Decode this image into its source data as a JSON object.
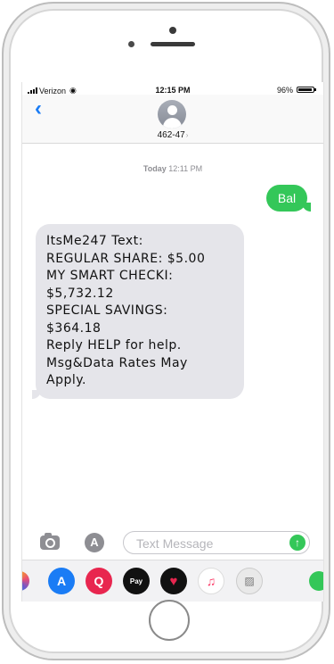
{
  "status_bar": {
    "carrier": "Verizon",
    "time": "12:15 PM",
    "battery": "96%",
    "battery_level": 0.96
  },
  "nav": {
    "back_icon": "chevron-left-icon",
    "contact": "462-47",
    "chevron": "›"
  },
  "thread": {
    "timestamp_day": "Today",
    "timestamp_time": "12:11 PM",
    "outgoing": "Bal",
    "incoming_lines": [
      "ItsMe247 Text:",
      "REGULAR SHARE: $5.00",
      "MY SMART CHECKI:",
      "$5,732.12",
      "SPECIAL SAVINGS:",
      "$364.18",
      "Reply HELP for help.",
      "Msg&Data Rates May",
      "Apply."
    ]
  },
  "compose": {
    "placeholder": "Text Message",
    "send_glyph": "↑",
    "appstore_glyph": "A"
  },
  "app_drawer": {
    "pay_label": "Pay",
    "store_glyph": "A",
    "search_glyph": "Q",
    "music_glyph": "♫",
    "notes_glyph": "▨",
    "heart_glyph": "♥"
  },
  "colors": {
    "outgoing_bubble": "#34c759",
    "incoming_bubble": "#e5e5ea",
    "accent": "#1a7cf5"
  }
}
